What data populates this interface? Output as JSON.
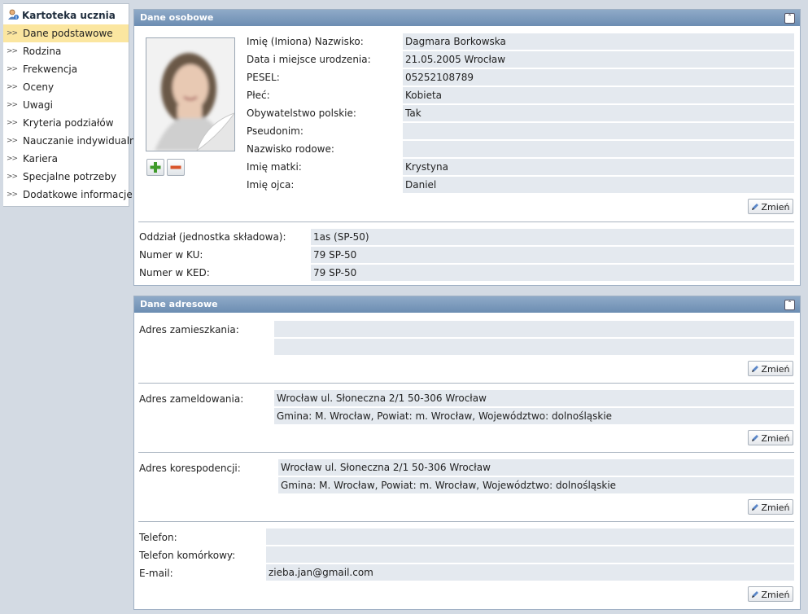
{
  "sidebar": {
    "title": "Kartoteka ucznia",
    "items": [
      {
        "label": "Dane podstawowe",
        "active": true
      },
      {
        "label": "Rodzina"
      },
      {
        "label": "Frekwencja"
      },
      {
        "label": "Oceny"
      },
      {
        "label": "Uwagi"
      },
      {
        "label": "Kryteria podziałów"
      },
      {
        "label": "Nauczanie indywidualne"
      },
      {
        "label": "Kariera"
      },
      {
        "label": "Specjalne potrzeby"
      },
      {
        "label": "Dodatkowe informacje"
      }
    ]
  },
  "personal": {
    "title": "Dane osobowe",
    "fields": [
      {
        "label": "Imię (Imiona) Nazwisko:",
        "value": "Dagmara  Borkowska"
      },
      {
        "label": "Data i miejsce urodzenia:",
        "value": "21.05.2005 Wrocław"
      },
      {
        "label": "PESEL:",
        "value": "05252108789"
      },
      {
        "label": "Płeć:",
        "value": "Kobieta"
      },
      {
        "label": "Obywatelstwo polskie:",
        "value": "Tak"
      },
      {
        "label": "Pseudonim:",
        "value": ""
      },
      {
        "label": "Nazwisko rodowe:",
        "value": ""
      },
      {
        "label": "Imię matki:",
        "value": "Krystyna"
      },
      {
        "label": "Imię ojca:",
        "value": "Daniel"
      }
    ],
    "edit_label": "Zmień",
    "school": [
      {
        "label": "Oddział (jednostka składowa):",
        "value": "1as (SP-50)"
      },
      {
        "label": "Numer w KU:",
        "value": "79 SP-50"
      },
      {
        "label": "Numer w KED:",
        "value": "79 SP-50"
      }
    ]
  },
  "address": {
    "title": "Dane adresowe",
    "residence": {
      "label": "Adres zamieszkania:",
      "line1": "",
      "line2": ""
    },
    "registered": {
      "label": "Adres zameldowania:",
      "line1": "Wrocław ul. Słoneczna 2/1 50-306 Wrocław",
      "line2": "Gmina: M. Wrocław, Powiat: m. Wrocław, Województwo: dolnośląskie"
    },
    "correspondence": {
      "label": "Adres korespodencji:",
      "line1": "Wrocław ul. Słoneczna 2/1 50-306 Wrocław",
      "line2": "Gmina: M. Wrocław, Powiat: m. Wrocław, Województwo: dolnośląskie"
    },
    "contact": [
      {
        "label": "Telefon:",
        "value": ""
      },
      {
        "label": "Telefon komórkowy:",
        "value": ""
      },
      {
        "label": "E-mail:",
        "value": "zieba.jan@gmail.com"
      }
    ],
    "edit_label": "Zmień"
  }
}
